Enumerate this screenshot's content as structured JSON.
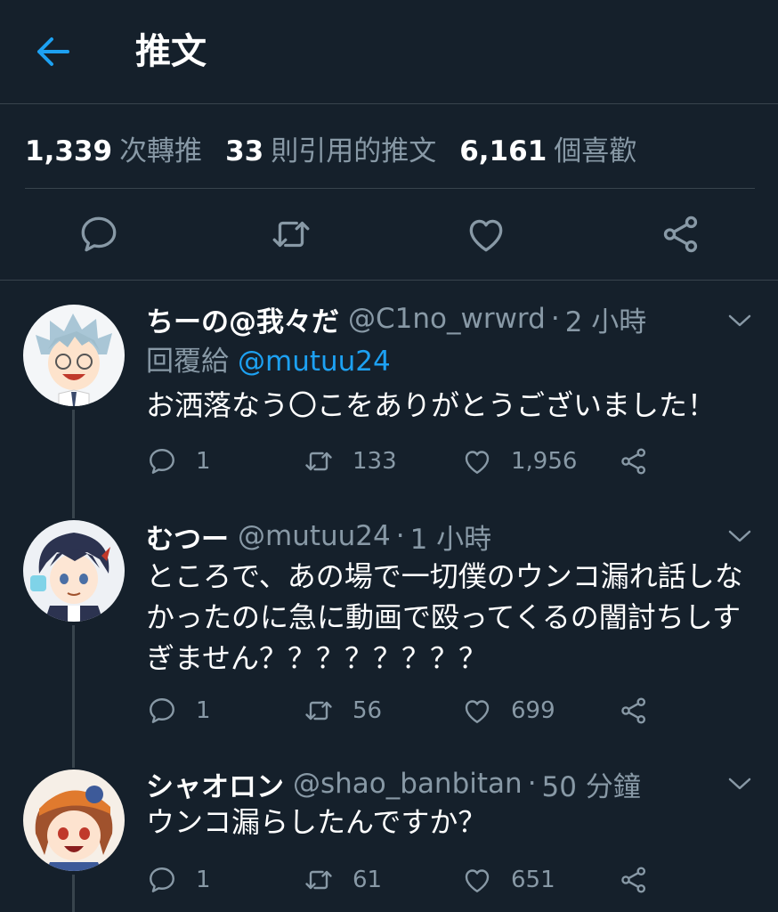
{
  "header": {
    "title": "推文",
    "back_icon": "arrow-left-icon"
  },
  "colors": {
    "background": "#15202b",
    "accent": "#1da1f2",
    "muted": "#8899a6",
    "divider": "#38444d"
  },
  "stats": {
    "retweets": {
      "count": "1,339",
      "label": "次轉推"
    },
    "quotes": {
      "count": "33",
      "label": "則引用的推文"
    },
    "likes": {
      "count": "6,161",
      "label": "個喜歡"
    }
  },
  "actions": [
    "reply-icon",
    "retweet-icon",
    "like-icon",
    "share-icon"
  ],
  "replies": [
    {
      "name": "ちーの@我々だ",
      "handle": "@C1no_wrwrd",
      "sep": "·",
      "time": "2 小時",
      "reply_to_label": "回覆給",
      "reply_to_user": "@mutuu24",
      "text": "お洒落なう〇こをありがとうございました！",
      "replies": "1",
      "retweets": "133",
      "likes": "1,956"
    },
    {
      "name": "むつー",
      "handle": "@mutuu24",
      "sep": "·",
      "time": "1 小時",
      "text": "ところで、あの場で一切僕のウンコ漏れ話しなかったのに急に動画で殴ってくるの闇討ちしすぎません？？？？？？？？",
      "replies": "1",
      "retweets": "56",
      "likes": "699"
    },
    {
      "name": "シャオロン",
      "handle": "@shao_banbitan",
      "sep": "·",
      "time": "50 分鐘",
      "text": "ウンコ漏らしたんですか？",
      "replies": "1",
      "retweets": "61",
      "likes": "651"
    }
  ]
}
